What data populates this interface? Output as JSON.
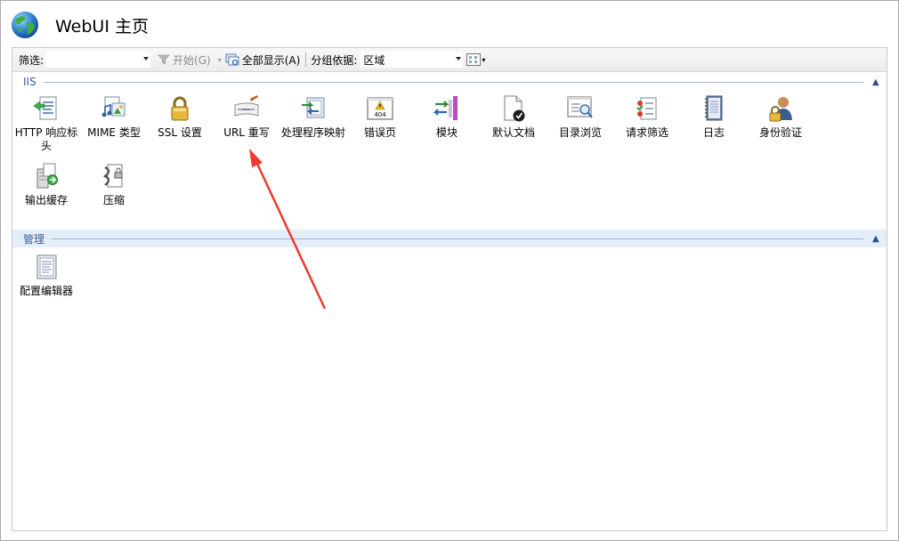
{
  "window": {
    "title": "WebUI 主页"
  },
  "toolbar": {
    "filter_label": "筛选:",
    "start_label": "开始(G)",
    "show_all_label": "全部显示(A)",
    "group_by_label": "分组依据:",
    "group_by_value": "区域"
  },
  "sections": {
    "iis": {
      "title": "IIS",
      "items": [
        {
          "label": "HTTP 响应标头",
          "icon": "http-response-headers-icon"
        },
        {
          "label": "MIME 类型",
          "icon": "mime-types-icon"
        },
        {
          "label": "SSL 设置",
          "icon": "ssl-lock-icon"
        },
        {
          "label": "URL 重写",
          "icon": "url-rewrite-icon"
        },
        {
          "label": "处理程序映射",
          "icon": "handler-mappings-icon"
        },
        {
          "label": "错误页",
          "icon": "error-pages-icon"
        },
        {
          "label": "模块",
          "icon": "modules-icon"
        },
        {
          "label": "默认文档",
          "icon": "default-document-icon"
        },
        {
          "label": "目录浏览",
          "icon": "directory-browsing-icon"
        },
        {
          "label": "请求筛选",
          "icon": "request-filtering-icon"
        },
        {
          "label": "日志",
          "icon": "logging-icon"
        },
        {
          "label": "身份验证",
          "icon": "authentication-icon"
        },
        {
          "label": "输出缓存",
          "icon": "output-caching-icon"
        },
        {
          "label": "压缩",
          "icon": "compression-icon"
        }
      ],
      "error_icon_text": "404"
    },
    "management": {
      "title": "管理",
      "items": [
        {
          "label": "配置编辑器",
          "icon": "configuration-editor-icon"
        }
      ]
    }
  },
  "colors": {
    "section_label": "#3c5a92",
    "management_band": "#e3eef9",
    "annotation_arrow": "#f03a2e"
  }
}
